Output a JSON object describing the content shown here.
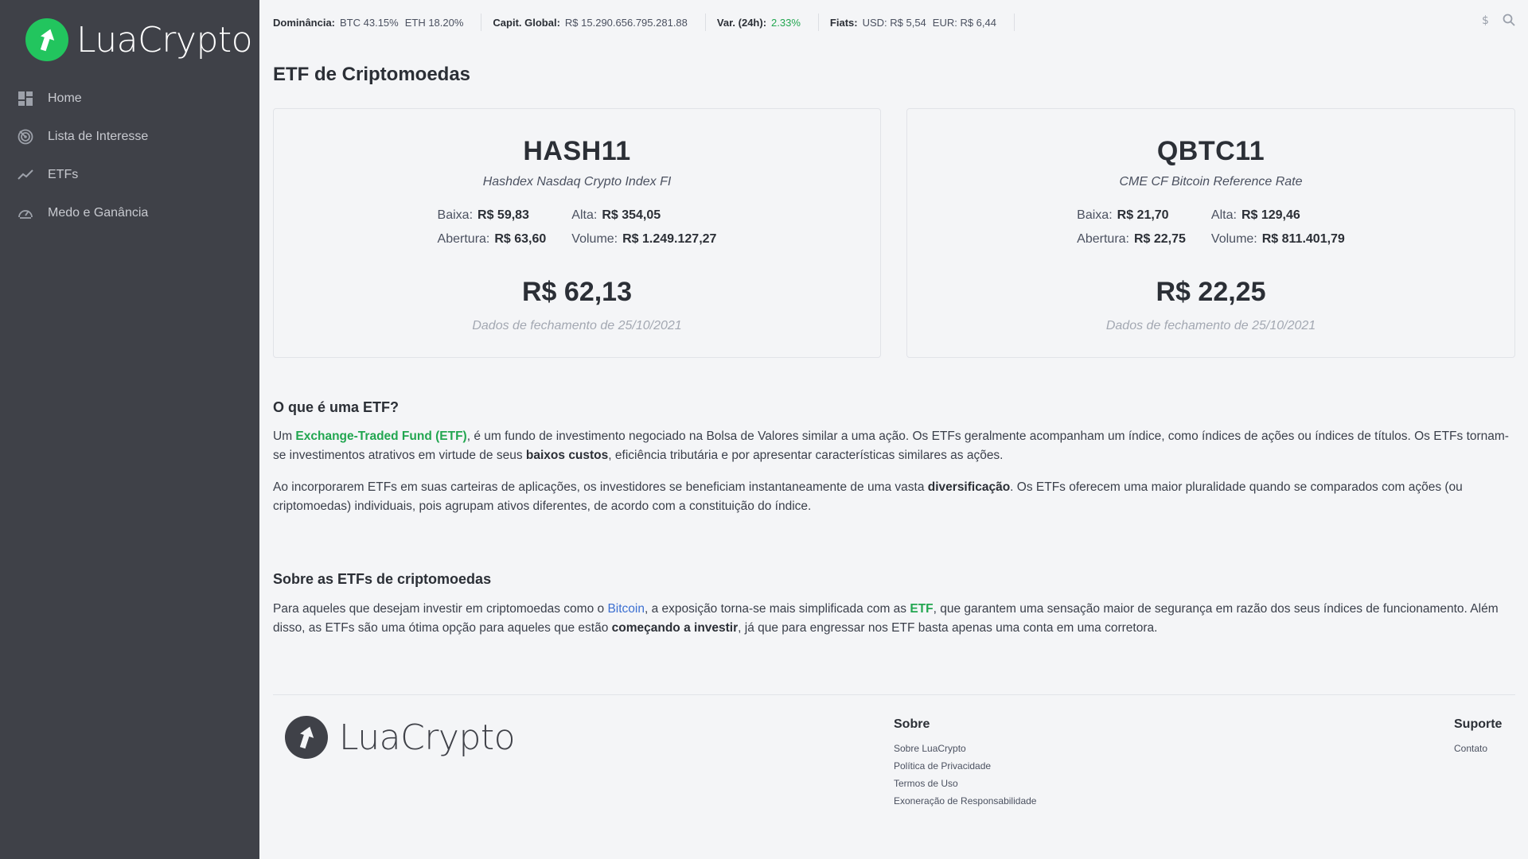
{
  "brand": {
    "name": "LuaCrypto"
  },
  "sidebar": {
    "items": [
      {
        "label": "Home",
        "icon": "dashboard-icon"
      },
      {
        "label": "Lista de Interesse",
        "icon": "radar-icon"
      },
      {
        "label": "ETFs",
        "icon": "trend-line-icon"
      },
      {
        "label": "Medo e Ganância",
        "icon": "gauge-icon"
      }
    ]
  },
  "topbar": {
    "dominance_label": "Dominância:",
    "dominance_btc": "BTC 43.15%",
    "dominance_eth": "ETH 18.20%",
    "cap_label": "Capit. Global:",
    "cap_value": "R$ 15.290.656.795.281.88",
    "var_label": "Var. (24h):",
    "var_value": "2.33%",
    "fiats_label": "Fiats:",
    "fiats_usd": "USD: R$ 5,54",
    "fiats_eur": "EUR: R$ 6,44",
    "icons": [
      "dollar-icon",
      "search-icon"
    ]
  },
  "page": {
    "title": "ETF de Criptomoedas"
  },
  "cards": [
    {
      "ticker": "HASH11",
      "subtitle": "Hashdex Nasdaq Crypto Index FI",
      "low_label": "Baixa:",
      "low": "R$ 59,83",
      "high_label": "Alta:",
      "high": "R$ 354,05",
      "open_label": "Abertura:",
      "open": "R$ 63,60",
      "volume_label": "Volume:",
      "volume": "R$ 1.249.127,27",
      "price": "R$ 62,13",
      "date": "Dados de fechamento de 25/10/2021"
    },
    {
      "ticker": "QBTC11",
      "subtitle": "CME CF Bitcoin Reference Rate",
      "low_label": "Baixa:",
      "low": "R$ 21,70",
      "high_label": "Alta:",
      "high": "R$ 129,46",
      "open_label": "Abertura:",
      "open": "R$ 22,75",
      "volume_label": "Volume:",
      "volume": "R$ 811.401,79",
      "price": "R$ 22,25",
      "date": "Dados de fechamento de 25/10/2021"
    }
  ],
  "what_is": {
    "title": "O que é uma ETF?",
    "p1_a": "Um ",
    "p1_link": "Exchange-Traded Fund (ETF)",
    "p1_b": ", é um fundo de investimento negociado na Bolsa de Valores similar a uma ação. Os ETFs geralmente acompanham um índice, como índices de ações ou índices de títulos. Os ETFs tornam-se investimentos atrativos em virtude de seus ",
    "p1_bold": "baixos custos",
    "p1_c": ", eficiência tributária e por apresentar características similares as ações.",
    "p2_a": "Ao incorporarem ETFs em suas carteiras de aplicações, os investidores se beneficiam instantaneamente de uma vasta ",
    "p2_bold": "diversificação",
    "p2_b": ". Os ETFs oferecem uma maior pluralidade quando se comparados com ações (ou criptomoedas) individuais, pois agrupam ativos diferentes, de acordo com a constituição do índice."
  },
  "about": {
    "title": "Sobre as ETFs de criptomoedas",
    "p_a": "Para aqueles que desejam investir em criptomoedas como o ",
    "p_link1": "Bitcoin",
    "p_b": ", a exposição torna-se mais simplificada com as ",
    "p_link2": "ETF",
    "p_c": ", que garantem uma sensação maior de segurança em razão dos seus índices de funcionamento. Além disso, as ETFs são uma ótima opção para aqueles que estão ",
    "p_bold": "começando a investir",
    "p_d": ", já que para engressar nos ETF basta apenas uma conta em uma corretora."
  },
  "footer": {
    "brand": "LuaCrypto",
    "sobre_title": "Sobre",
    "sobre_links": [
      "Sobre LuaCrypto",
      "Política de Privacidade",
      "Termos de Uso",
      "Exoneração de Responsabilidade"
    ],
    "suporte_title": "Suporte",
    "suporte_links": [
      "Contato"
    ]
  },
  "colors": {
    "sidebar_bg": "#3f4148",
    "accent_green": "#22c55e",
    "link_blue": "#3b6fd1",
    "page_bg": "#f4f5f7"
  }
}
